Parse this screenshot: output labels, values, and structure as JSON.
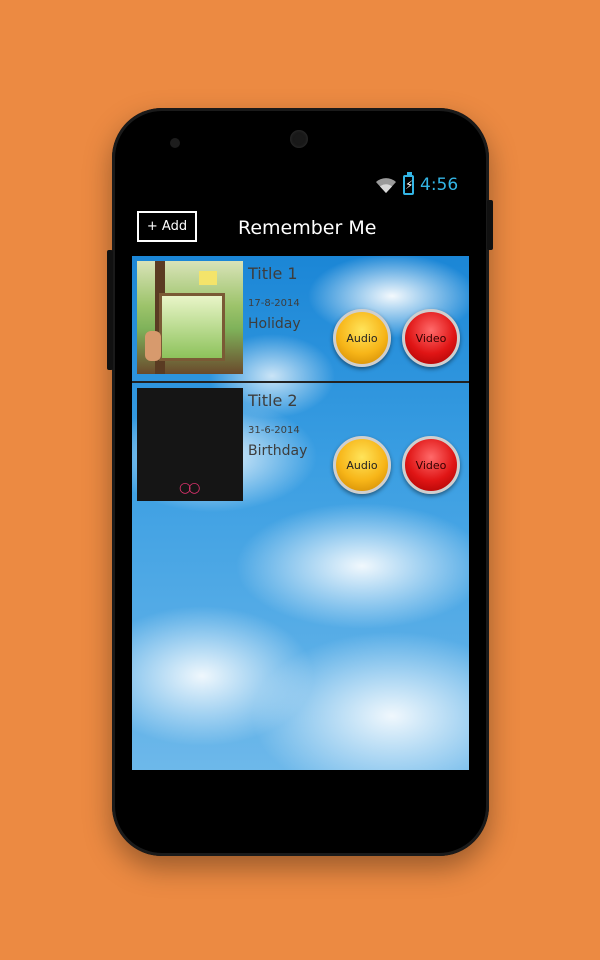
{
  "status": {
    "time": "4:56",
    "wifi_icon": "wifi-icon",
    "battery_icon": "battery-charging-icon",
    "accent": "#33B5E5"
  },
  "actionbar": {
    "add_label": "+ Add",
    "title": "Remember Me"
  },
  "items": [
    {
      "title": "Title 1",
      "date": "17-8-2014",
      "description": "Holiday",
      "audio_label": "Audio",
      "video_label": "Video"
    },
    {
      "title": "Title 2",
      "date": "31-6-2014",
      "description": "Birthday",
      "audio_label": "Audio",
      "video_label": "Video"
    }
  ],
  "colors": {
    "background": "#EC8A42",
    "audio": "#F7B518",
    "video": "#E01515"
  }
}
